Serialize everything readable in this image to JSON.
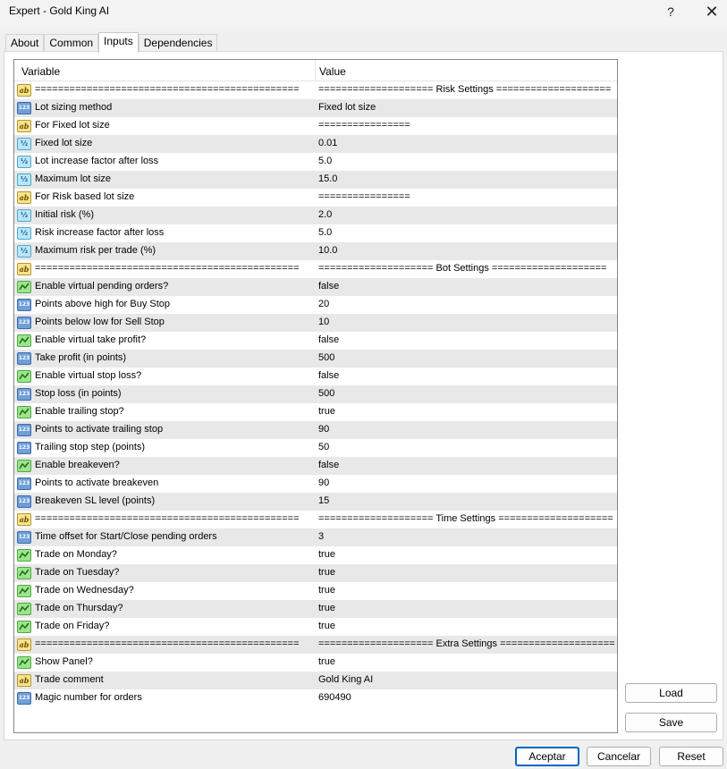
{
  "window": {
    "title": "Expert - Gold King AI",
    "help_label": "?",
    "close_label": "✕"
  },
  "tabs": [
    {
      "label": "About",
      "active": false
    },
    {
      "label": "Common",
      "active": false
    },
    {
      "label": "Inputs",
      "active": true
    },
    {
      "label": "Dependencies",
      "active": false
    }
  ],
  "grid": {
    "headers": {
      "variable": "Variable",
      "value": "Value"
    },
    "rows": [
      {
        "type": "text",
        "variable": "==============================================",
        "value": "==================== Risk Settings ===================="
      },
      {
        "type": "int",
        "variable": "Lot sizing method",
        "value": "Fixed lot size"
      },
      {
        "type": "text",
        "variable": "For Fixed lot size",
        "value": "================"
      },
      {
        "type": "double",
        "variable": "Fixed lot size",
        "value": "0.01"
      },
      {
        "type": "double",
        "variable": "Lot increase factor after loss",
        "value": "5.0"
      },
      {
        "type": "double",
        "variable": "Maximum lot size",
        "value": "15.0"
      },
      {
        "type": "text",
        "variable": "For Risk based lot size",
        "value": "================"
      },
      {
        "type": "double",
        "variable": "Initial risk (%)",
        "value": "2.0"
      },
      {
        "type": "double",
        "variable": "Risk increase factor after loss",
        "value": "5.0"
      },
      {
        "type": "double",
        "variable": "Maximum risk per trade (%)",
        "value": "10.0"
      },
      {
        "type": "text",
        "variable": "==============================================",
        "value": "==================== Bot Settings ===================="
      },
      {
        "type": "bool",
        "variable": "Enable virtual pending orders?",
        "value": "false"
      },
      {
        "type": "int",
        "variable": "Points above high for Buy Stop",
        "value": "20"
      },
      {
        "type": "int",
        "variable": "Points below low for Sell Stop",
        "value": "10"
      },
      {
        "type": "bool",
        "variable": "Enable virtual take profit?",
        "value": "false"
      },
      {
        "type": "int",
        "variable": "Take profit (in points)",
        "value": "500"
      },
      {
        "type": "bool",
        "variable": "Enable virtual stop loss?",
        "value": "false"
      },
      {
        "type": "int",
        "variable": "Stop loss (in points)",
        "value": "500"
      },
      {
        "type": "bool",
        "variable": "Enable trailing stop?",
        "value": "true"
      },
      {
        "type": "int",
        "variable": "Points to activate trailing stop",
        "value": "90"
      },
      {
        "type": "int",
        "variable": "Trailing stop step (points)",
        "value": "50"
      },
      {
        "type": "bool",
        "variable": "Enable breakeven?",
        "value": "false"
      },
      {
        "type": "int",
        "variable": "Points to activate breakeven",
        "value": "90"
      },
      {
        "type": "int",
        "variable": "Breakeven SL level (points)",
        "value": "15"
      },
      {
        "type": "text",
        "variable": "==============================================",
        "value": "==================== Time Settings ===================="
      },
      {
        "type": "int",
        "variable": "Time offset for Start/Close pending orders",
        "value": "3"
      },
      {
        "type": "bool",
        "variable": "Trade on Monday?",
        "value": "true"
      },
      {
        "type": "bool",
        "variable": "Trade on Tuesday?",
        "value": "true"
      },
      {
        "type": "bool",
        "variable": "Trade on Wednesday?",
        "value": "true"
      },
      {
        "type": "bool",
        "variable": "Trade on Thursday?",
        "value": "true"
      },
      {
        "type": "bool",
        "variable": "Trade on Friday?",
        "value": "true"
      },
      {
        "type": "text",
        "variable": "==============================================",
        "value": "==================== Extra Settings ===================="
      },
      {
        "type": "bool",
        "variable": "Show Panel?",
        "value": "true"
      },
      {
        "type": "text",
        "variable": "Trade comment",
        "value": "Gold King AI"
      },
      {
        "type": "int",
        "variable": "Magic number for orders",
        "value": "690490"
      }
    ]
  },
  "icons": {
    "text": "ab",
    "int": "123",
    "double": "½",
    "bool": ""
  },
  "side_buttons": {
    "load": "Load",
    "save": "Save"
  },
  "footer_buttons": {
    "ok": "Aceptar",
    "cancel": "Cancelar",
    "reset": "Reset"
  }
}
